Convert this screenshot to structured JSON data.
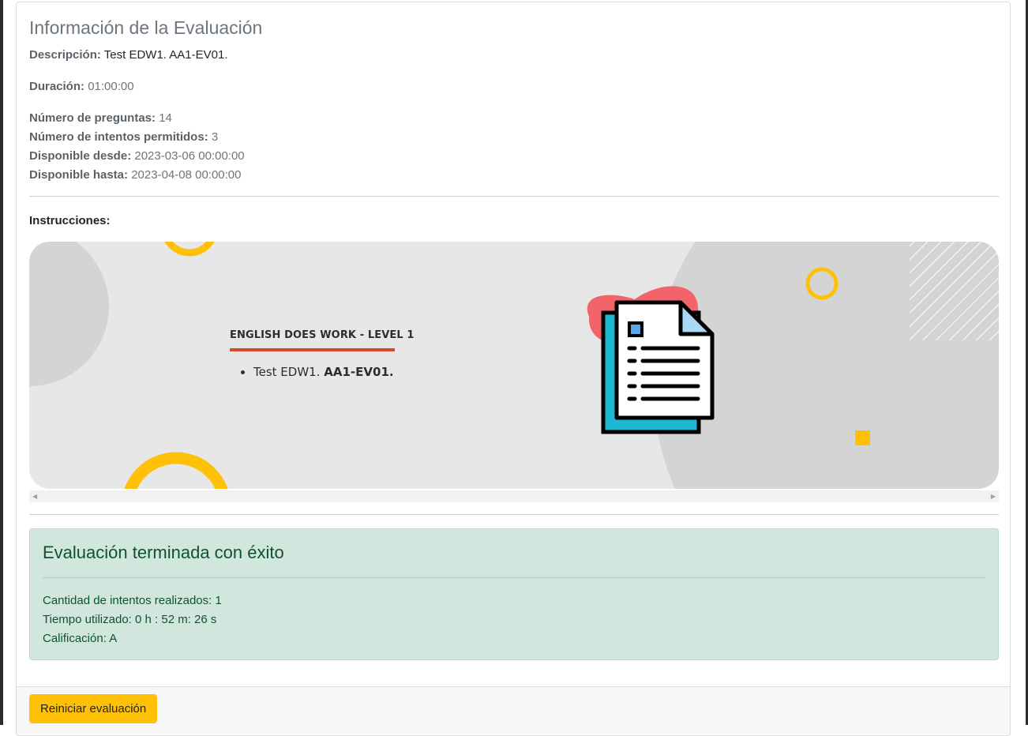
{
  "evaluation": {
    "title": "Información de la Evaluación",
    "description_label": "Descripción:",
    "description_value": "Test EDW1. AA1-EV01.",
    "duration_label": "Duración:",
    "duration_value": "01:00:00",
    "questions_label": "Número de preguntas:",
    "questions_value": "14",
    "attempts_label": "Número de intentos permitidos:",
    "attempts_value": "3",
    "from_label": "Disponible desde:",
    "from_value": "2023-03-06 00:00:00",
    "until_label": "Disponible hasta:",
    "until_value": "2023-04-08 00:00:00",
    "instructions_label": "Instrucciones:"
  },
  "banner": {
    "heading": "ENGLISH DOES WORK - LEVEL 1",
    "item_text": "Test EDW1.",
    "item_bold": "AA1-EV01.",
    "icon": "document-icon",
    "colors": {
      "background": "#e7e7e7",
      "circle_gray": "#d4d4d4",
      "yellow": "#ffc107",
      "red_blob": "#f2646a",
      "doc_back": "#1fb8d3",
      "underline": "#d9482a"
    }
  },
  "result": {
    "title": "Evaluación terminada con éxito",
    "attempts_done": "Cantidad de intentos realizados: 1",
    "time_used": "Tiempo utilizado: 0 h : 52 m: 26 s",
    "grade": "Calificación: A"
  },
  "footer": {
    "restart_label": "Reiniciar evaluación"
  },
  "colors": {
    "success_bg": "#d1e7dd",
    "success_text": "#0f5132",
    "warning": "#ffc107",
    "muted": "#6c757d"
  }
}
